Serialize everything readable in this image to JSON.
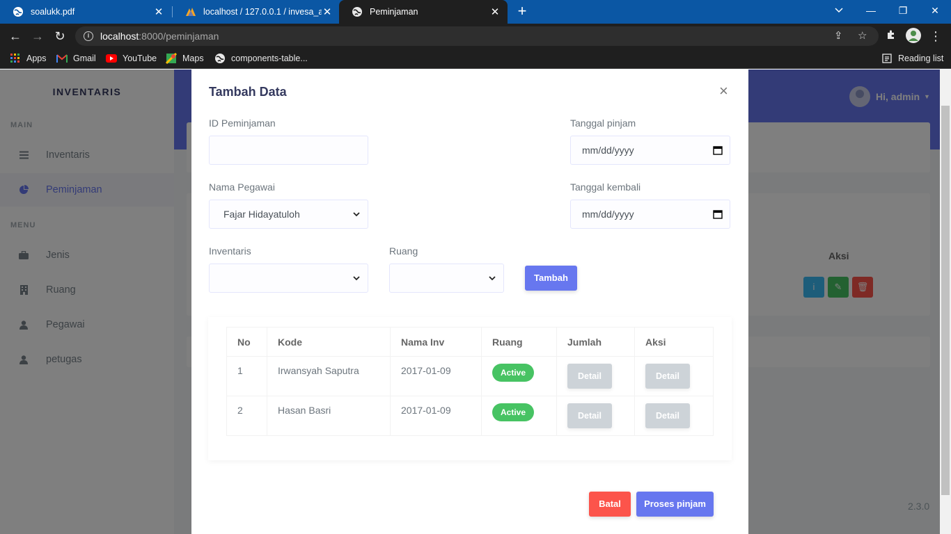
{
  "browser": {
    "tabs": [
      {
        "title": "soalukk.pdf",
        "icon": "globe-icon"
      },
      {
        "title": "localhost / 127.0.0.1 / invesa_anti",
        "icon": "phpmyadmin-icon"
      },
      {
        "title": "Peminjaman",
        "icon": "globe-icon"
      }
    ],
    "url_host": "localhost",
    "url_path": ":8000/peminjaman",
    "bookmarks": [
      {
        "label": "Apps",
        "icon": "apps-grid-icon"
      },
      {
        "label": "Gmail",
        "icon": "gmail-icon"
      },
      {
        "label": "YouTube",
        "icon": "youtube-icon"
      },
      {
        "label": "Maps",
        "icon": "maps-icon"
      },
      {
        "label": "components-table...",
        "icon": "globe-icon"
      }
    ],
    "reading_list": "Reading list"
  },
  "sidebar": {
    "brand": "INVENTARIS",
    "main_header": "MAIN",
    "menu_header": "MENU",
    "items": [
      {
        "label": "Inventaris",
        "icon": "list-icon"
      },
      {
        "label": "Peminjaman",
        "icon": "pie-chart-icon",
        "active": true
      },
      {
        "label": "Jenis",
        "icon": "briefcase-icon"
      },
      {
        "label": "Ruang",
        "icon": "building-icon"
      },
      {
        "label": "Pegawai",
        "icon": "user-icon"
      },
      {
        "label": "petugas",
        "icon": "user-icon"
      }
    ]
  },
  "header": {
    "greeting": "Hi, admin"
  },
  "background": {
    "aksi_header": "Aksi",
    "version": "2.3.0"
  },
  "modal": {
    "title": "Tambah Data",
    "close": "×",
    "id_label": "ID Peminjaman",
    "id_value": "",
    "tgl_pinjam_label": "Tanggal pinjam",
    "tgl_pinjam_value": "mm/dd/yyyy",
    "nama_label": "Nama Pegawai",
    "nama_value": "Fajar Hidayatuloh",
    "tgl_kembali_label": "Tanggal kembali",
    "tgl_kembali_value": "mm/dd/yyyy",
    "inventaris_label": "Inventaris",
    "inventaris_value": "",
    "ruang_label": "Ruang",
    "ruang_value": "",
    "tambah_label": "Tambah",
    "table": {
      "headers": [
        "No",
        "Kode",
        "Nama Inv",
        "Ruang",
        "Jumlah",
        "Aksi"
      ],
      "rows": [
        {
          "no": "1",
          "kode": "Irwansyah Saputra",
          "nama_inv": "2017-01-09",
          "ruang": "Active",
          "jumlah": "Detail",
          "aksi": "Detail"
        },
        {
          "no": "2",
          "kode": "Hasan Basri",
          "nama_inv": "2017-01-09",
          "ruang": "Active",
          "jumlah": "Detail",
          "aksi": "Detail"
        }
      ]
    },
    "batal_label": "Batal",
    "proses_label": "Proses pinjam"
  },
  "colors": {
    "primary": "#6777ef",
    "success": "#47c363",
    "danger": "#fc544b",
    "info": "#3abaf4",
    "chrome_tabbar": "#0b57a4"
  }
}
